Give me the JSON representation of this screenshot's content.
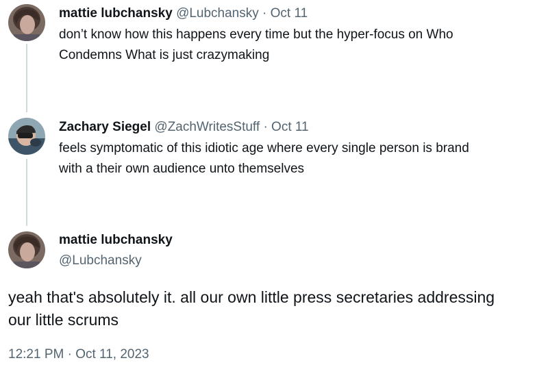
{
  "thread": [
    {
      "name": "mattie lubchansky",
      "handle": "@Lubchansky",
      "separator": "·",
      "date": "Oct 11",
      "text_line1": "don’t know how this happens every time but the hyper-focus on Who",
      "text_line2": "Condemns What is just crazymaking"
    },
    {
      "name": "Zachary Siegel",
      "handle": "@ZachWritesStuff",
      "separator": "·",
      "date": "Oct 11",
      "text_line1": "feels symptomatic of this idiotic age where every single person is brand",
      "text_line2": "with a their own audience unto themselves"
    }
  ],
  "main_tweet": {
    "name": "mattie lubchansky",
    "handle": "@Lubchansky",
    "text_line1": "yeah that's absolutely it. all our own little press secretaries addressing",
    "text_line2": "our little scrums",
    "timestamp": "12:21 PM · Oct 11, 2023"
  },
  "colors": {
    "text": "#0f1419",
    "secondary": "#536471",
    "thread_line": "#cfd9de"
  }
}
